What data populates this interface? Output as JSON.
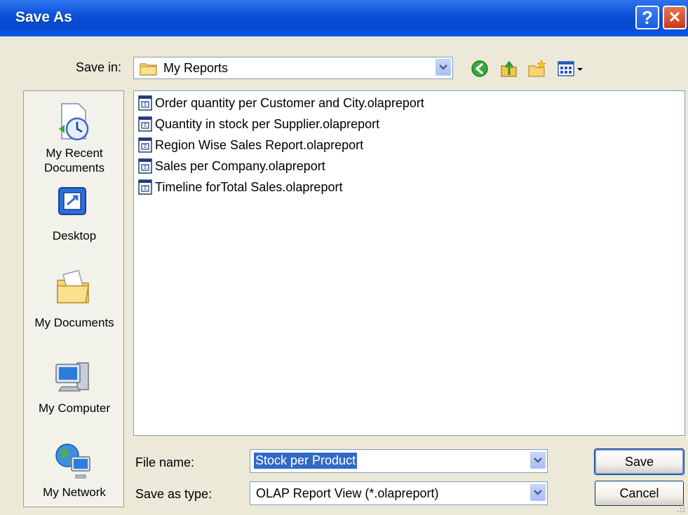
{
  "window": {
    "title": "Save As",
    "help_label": "?",
    "close_label": "✕"
  },
  "toolbar": {
    "save_in_label": "Save in:",
    "save_in_value": "My Reports",
    "back_icon": "back-arrow-icon",
    "up_icon": "up-folder-icon",
    "new_folder_icon": "new-folder-icon",
    "views_icon": "views-menu-icon"
  },
  "places": [
    {
      "label_line1": "My Recent",
      "label_line2": "Documents",
      "icon": "recent-documents-icon"
    },
    {
      "label_line1": "Desktop",
      "label_line2": "",
      "icon": "desktop-icon"
    },
    {
      "label_line1": "My Documents",
      "label_line2": "",
      "icon": "my-documents-icon"
    },
    {
      "label_line1": "My Computer",
      "label_line2": "",
      "icon": "my-computer-icon"
    },
    {
      "label_line1": "My Network",
      "label_line2": "",
      "icon": "my-network-icon"
    }
  ],
  "files": [
    "Order quantity per Customer and City.olapreport",
    "Quantity in stock per Supplier.olapreport",
    "Region Wise Sales Report.olapreport",
    "Sales per Company.olapreport",
    "Timeline forTotal Sales.olapreport"
  ],
  "form": {
    "file_name_label": "File name:",
    "file_name_value": "Stock per Product",
    "save_as_type_label": "Save as type:",
    "save_as_type_value": "OLAP Report View (*.olapreport)"
  },
  "buttons": {
    "save_label": "Save",
    "cancel_label": "Cancel"
  },
  "colors": {
    "titlebar": "#0A4FD6",
    "dialog_bg": "#ECE9D8",
    "selection": "#316AC5"
  }
}
